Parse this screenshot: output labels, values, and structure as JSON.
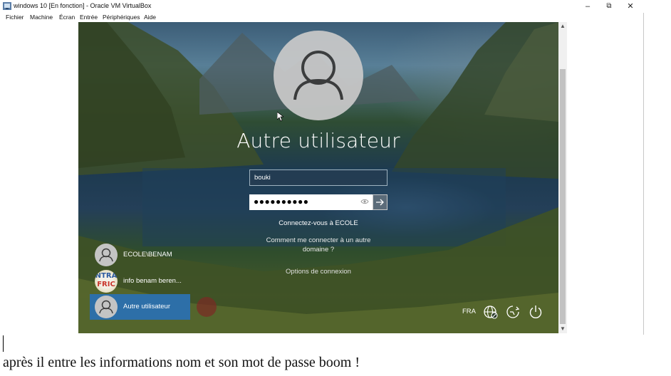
{
  "window": {
    "title": "windows 10 [En fonction] - Oracle VM VirtualBox",
    "icon": "virtualbox-icon",
    "controls": {
      "minimize": "–",
      "maximize": "⧉",
      "close": "✕"
    }
  },
  "menu": [
    "Fichier",
    "Machine",
    "Écran",
    "Entrée",
    "Périphériques",
    "Aide"
  ],
  "login": {
    "heading": "Autre utilisateur",
    "username_value": "bouki",
    "password_mask": "●●●●●●●●●●",
    "reveal_icon": "eye-icon",
    "submit_icon": "arrow-right-icon",
    "sign_in_to": "Connectez-vous à ECOLE",
    "other_domain_line1": "Comment me connecter à un autre",
    "other_domain_line2": "domaine ?",
    "signin_options": "Options de connexion"
  },
  "users": [
    {
      "label": "ECOLE\\BENAM",
      "icon": "user-icon"
    },
    {
      "label": "info benam beren...",
      "icon": "entra-avatar",
      "avatar_line1": "NTRA",
      "avatar_line2": "FRIC"
    },
    {
      "label": "Autre utilisateur",
      "icon": "user-icon",
      "selected": true
    }
  ],
  "tray": {
    "language": "FRA",
    "icons": [
      "network-icon",
      "accessibility-icon",
      "power-icon"
    ]
  },
  "colors": {
    "selected_tile": "#2d6fa8",
    "heading": "#ffffff"
  },
  "caption": "après il entre les informations nom et son mot de passe boom !"
}
